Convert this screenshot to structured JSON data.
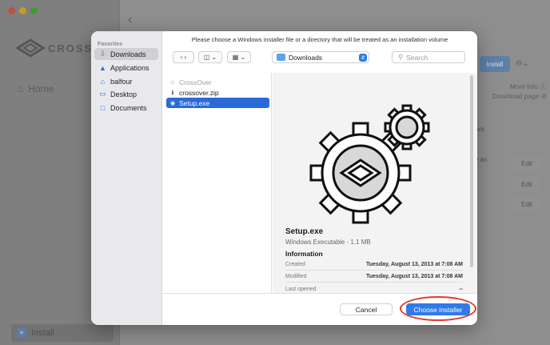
{
  "background": {
    "brand_text": "CROSSOV",
    "home_label": "Home",
    "install_button": "Install",
    "more_info_link": "More info ⓘ",
    "download_page_link": "Download page ⊘",
    "fragments": [
      "eam.",
      "ve an"
    ],
    "edit_labels": [
      "Edit",
      "Edit",
      "Edit"
    ],
    "bottom_install_label": "Install"
  },
  "dialog": {
    "prompt": "Please choose a Windows installer file or a directory that will be treated as an installation volume",
    "sidebar": {
      "header": "Favorites",
      "items": [
        {
          "label": "Downloads",
          "icon": "download-icon",
          "selected": true
        },
        {
          "label": "Applications",
          "icon": "applications-icon",
          "selected": false
        },
        {
          "label": "balfour",
          "icon": "home-icon",
          "selected": false
        },
        {
          "label": "Desktop",
          "icon": "desktop-icon",
          "selected": false
        },
        {
          "label": "Documents",
          "icon": "document-icon",
          "selected": false
        }
      ]
    },
    "toolbar": {
      "location": "Downloads",
      "search_placeholder": "Search"
    },
    "files": [
      {
        "name": "CrossOver",
        "dimmed": true,
        "selected": false
      },
      {
        "name": "crossover.zip",
        "dimmed": false,
        "selected": false
      },
      {
        "name": "Setup.exe",
        "dimmed": false,
        "selected": true
      }
    ],
    "preview": {
      "name": "Setup.exe",
      "kind": "Windows Executable - 1.1 MB",
      "info_header": "Information",
      "rows": [
        {
          "key": "Created",
          "value": "Tuesday, August 13, 2013 at 7:08 AM"
        },
        {
          "key": "Modified",
          "value": "Tuesday, August 13, 2013 at 7:08 AM"
        },
        {
          "key": "Last opened",
          "value": "--"
        }
      ]
    },
    "footer": {
      "cancel_label": "Cancel",
      "choose_label": "Choose installer"
    }
  },
  "colors": {
    "accent": "#2f7be8",
    "selection": "#2a6ad8",
    "annotation": "#e23a2a"
  }
}
